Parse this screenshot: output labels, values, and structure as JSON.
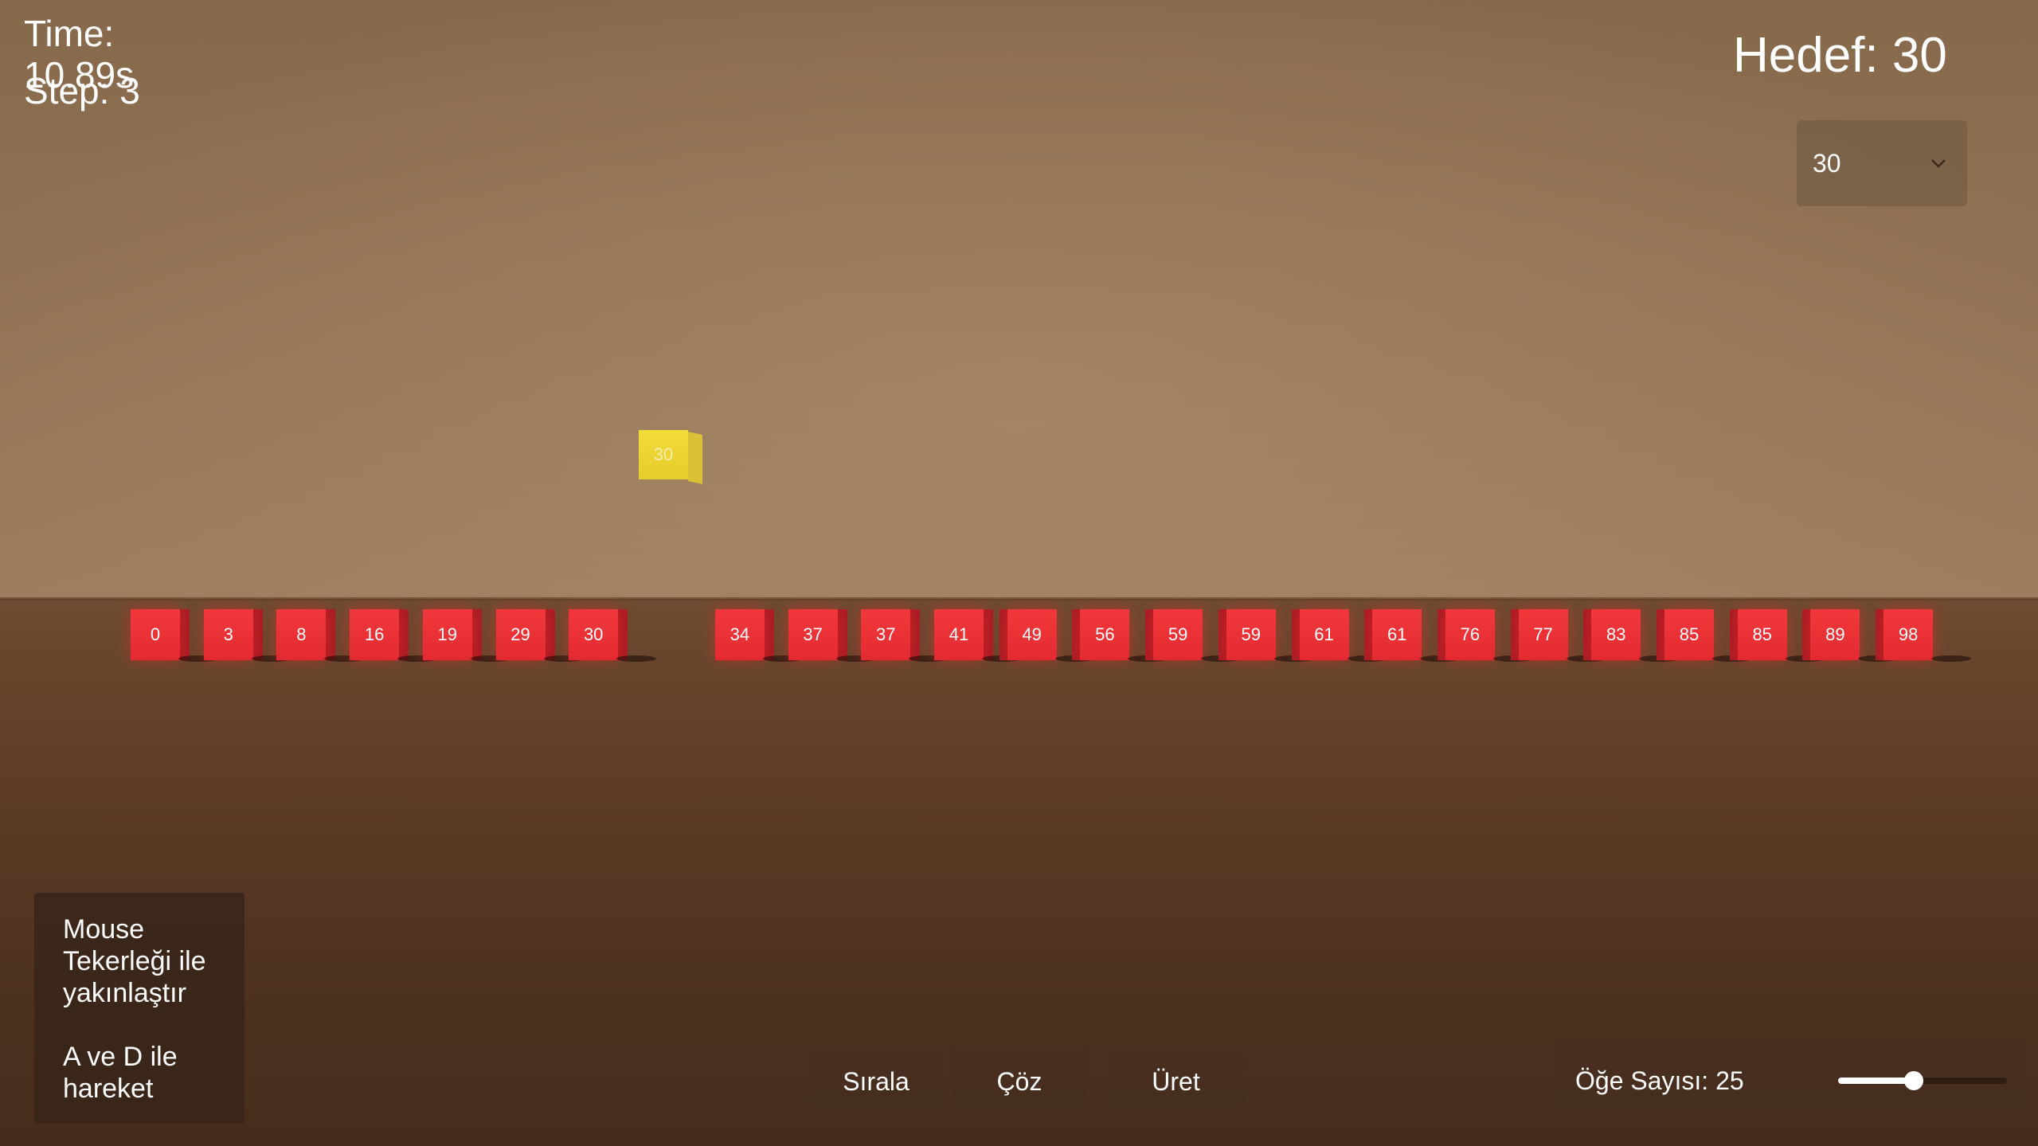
{
  "hud": {
    "time": "Time: 10.89s",
    "step": "Step: 3",
    "target": "Hedef: 30"
  },
  "target_dropdown": {
    "selected": "30",
    "icon": "chevron-down-icon"
  },
  "array": [
    0,
    3,
    8,
    16,
    19,
    29,
    30,
    34,
    37,
    37,
    41,
    49,
    56,
    59,
    59,
    61,
    61,
    76,
    77,
    83,
    85,
    85,
    89,
    98
  ],
  "floating_cube": {
    "value": "30",
    "color": "#f2dc3a"
  },
  "cube_color": "#e22a30",
  "help": {
    "zoom": "Mouse Tekerleği ile yakınlaştır",
    "move": "A ve D ile hareket"
  },
  "buttons": {
    "sort": "Sırala",
    "solve": "Çöz",
    "generate": "Üret"
  },
  "item_count": {
    "label": "Öğe Sayısı: 25",
    "value": 25,
    "slider_fraction": 0.45
  }
}
